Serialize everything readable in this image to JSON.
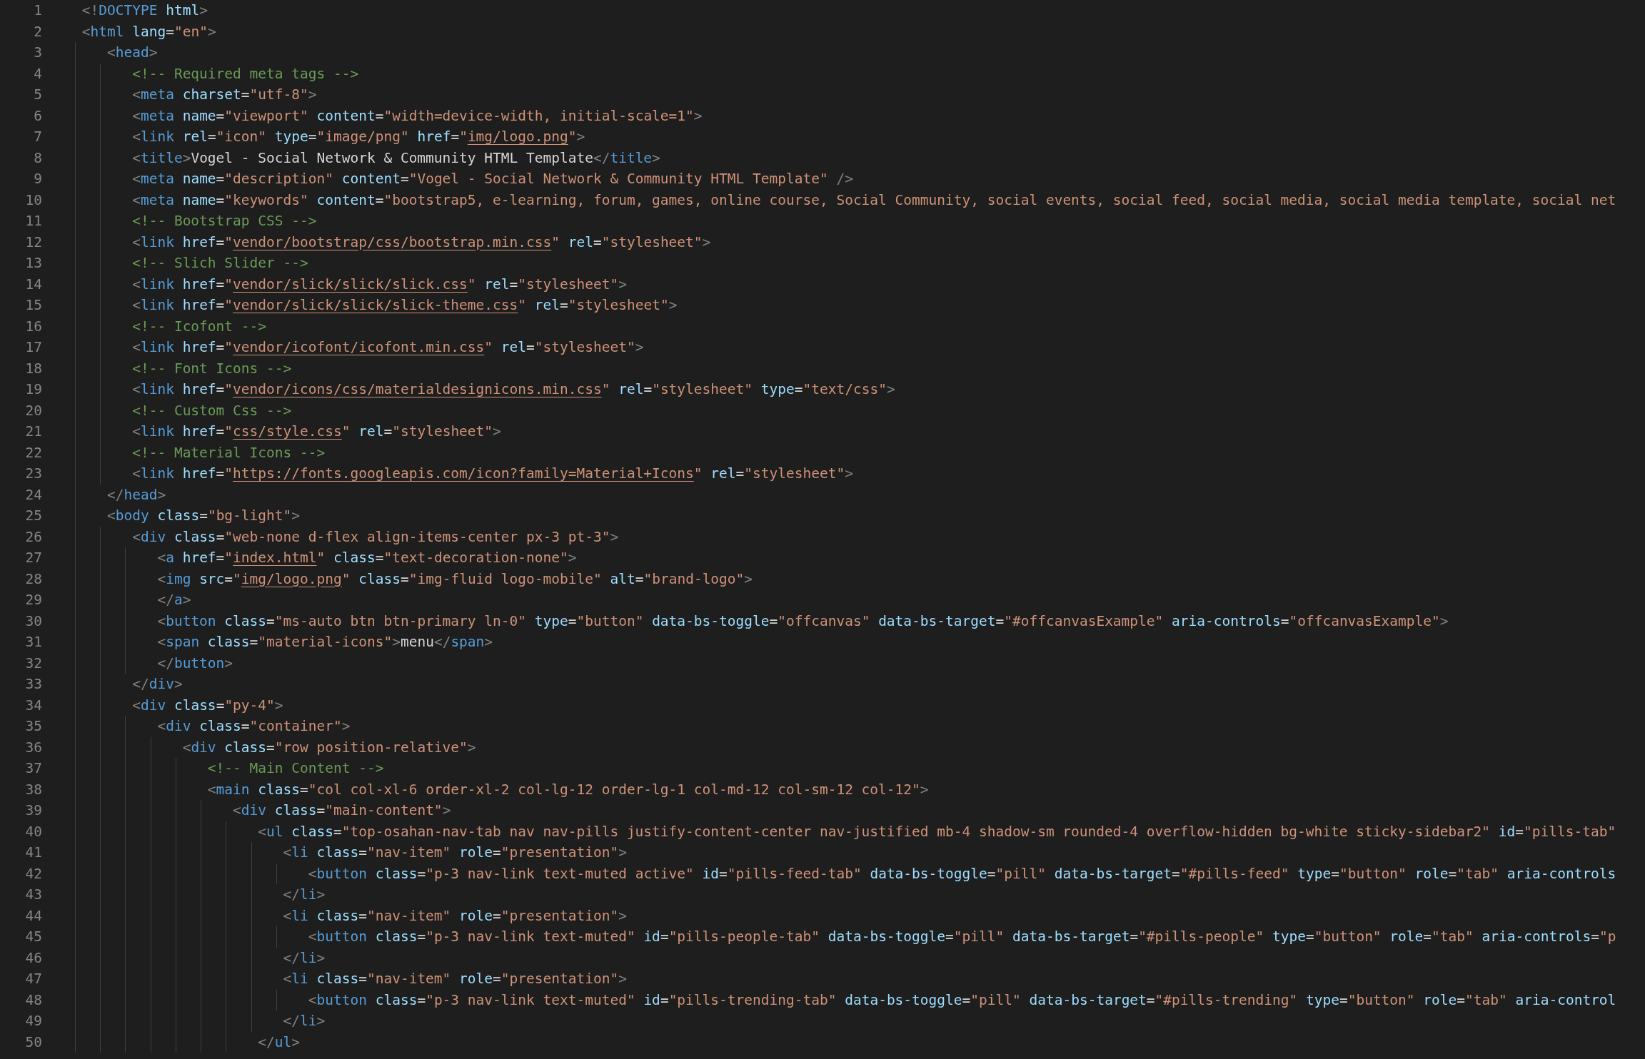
{
  "lines": [
    {
      "number": "1",
      "code": [
        {
          "kind": "p",
          "text": "<!"
        },
        {
          "kind": "g",
          "text": "DOCTYPE"
        },
        {
          "kind": "a",
          "text": " html"
        },
        {
          "kind": "p",
          "text": ">"
        }
      ]
    },
    {
      "number": "2",
      "code": [
        {
          "kind": "p",
          "text": "<"
        },
        {
          "kind": "g",
          "text": "html"
        },
        {
          "kind": "a",
          "text": " lang"
        },
        {
          "kind": "x",
          "text": "="
        },
        {
          "kind": "s",
          "text": "\"en\""
        },
        {
          "kind": "p",
          "text": ">"
        }
      ]
    },
    {
      "number": "3",
      "code": [
        {
          "kind": "p",
          "text": "   <"
        },
        {
          "kind": "g",
          "text": "head"
        },
        {
          "kind": "p",
          "text": ">"
        }
      ]
    },
    {
      "number": "4",
      "code": [
        {
          "kind": "c",
          "text": "      <!-- Required meta tags -->"
        }
      ]
    },
    {
      "number": "5",
      "code": [
        {
          "kind": "p",
          "text": "      <"
        },
        {
          "kind": "g",
          "text": "meta"
        },
        {
          "kind": "a",
          "text": " charset"
        },
        {
          "kind": "x",
          "text": "="
        },
        {
          "kind": "s",
          "text": "\"utf-8\""
        },
        {
          "kind": "p",
          "text": ">"
        }
      ]
    },
    {
      "number": "6",
      "code": [
        {
          "kind": "p",
          "text": "      <"
        },
        {
          "kind": "g",
          "text": "meta"
        },
        {
          "kind": "a",
          "text": " name"
        },
        {
          "kind": "x",
          "text": "="
        },
        {
          "kind": "s",
          "text": "\"viewport\""
        },
        {
          "kind": "a",
          "text": " content"
        },
        {
          "kind": "x",
          "text": "="
        },
        {
          "kind": "s",
          "text": "\"width=device-width, initial-scale=1\""
        },
        {
          "kind": "p",
          "text": ">"
        }
      ]
    },
    {
      "number": "7",
      "code": [
        {
          "kind": "p",
          "text": "      <"
        },
        {
          "kind": "g",
          "text": "link"
        },
        {
          "kind": "a",
          "text": " rel"
        },
        {
          "kind": "x",
          "text": "="
        },
        {
          "kind": "s",
          "text": "\"icon\""
        },
        {
          "kind": "a",
          "text": " type"
        },
        {
          "kind": "x",
          "text": "="
        },
        {
          "kind": "s",
          "text": "\"image/png\""
        },
        {
          "kind": "a",
          "text": " href"
        },
        {
          "kind": "x",
          "text": "="
        },
        {
          "kind": "s",
          "text": "\""
        },
        {
          "kind": "u",
          "text": "img/logo.png"
        },
        {
          "kind": "s",
          "text": "\""
        },
        {
          "kind": "p",
          "text": ">"
        }
      ]
    },
    {
      "number": "8",
      "code": [
        {
          "kind": "p",
          "text": "      <"
        },
        {
          "kind": "g",
          "text": "title"
        },
        {
          "kind": "p",
          "text": ">"
        },
        {
          "kind": "x",
          "text": "Vogel - Social Network & Community HTML Template"
        },
        {
          "kind": "p",
          "text": "</"
        },
        {
          "kind": "g",
          "text": "title"
        },
        {
          "kind": "p",
          "text": ">"
        }
      ]
    },
    {
      "number": "9",
      "code": [
        {
          "kind": "p",
          "text": "      <"
        },
        {
          "kind": "g",
          "text": "meta"
        },
        {
          "kind": "a",
          "text": " name"
        },
        {
          "kind": "x",
          "text": "="
        },
        {
          "kind": "s",
          "text": "\"description\""
        },
        {
          "kind": "a",
          "text": " content"
        },
        {
          "kind": "x",
          "text": "="
        },
        {
          "kind": "s",
          "text": "\"Vogel - Social Network & Community HTML Template\""
        },
        {
          "kind": "p",
          "text": " />"
        }
      ]
    },
    {
      "number": "10",
      "code": [
        {
          "kind": "p",
          "text": "      <"
        },
        {
          "kind": "g",
          "text": "meta"
        },
        {
          "kind": "a",
          "text": " name"
        },
        {
          "kind": "x",
          "text": "="
        },
        {
          "kind": "s",
          "text": "\"keywords\""
        },
        {
          "kind": "a",
          "text": " content"
        },
        {
          "kind": "x",
          "text": "="
        },
        {
          "kind": "s",
          "text": "\"bootstrap5, e-learning, forum, games, online course, Social Community, social events, social feed, social media, social media template, social net"
        }
      ]
    },
    {
      "number": "11",
      "code": [
        {
          "kind": "c",
          "text": "      <!-- Bootstrap CSS -->"
        }
      ]
    },
    {
      "number": "12",
      "code": [
        {
          "kind": "p",
          "text": "      <"
        },
        {
          "kind": "g",
          "text": "link"
        },
        {
          "kind": "a",
          "text": " href"
        },
        {
          "kind": "x",
          "text": "="
        },
        {
          "kind": "s",
          "text": "\""
        },
        {
          "kind": "u",
          "text": "vendor/bootstrap/css/bootstrap.min.css"
        },
        {
          "kind": "s",
          "text": "\""
        },
        {
          "kind": "a",
          "text": " rel"
        },
        {
          "kind": "x",
          "text": "="
        },
        {
          "kind": "s",
          "text": "\"stylesheet\""
        },
        {
          "kind": "p",
          "text": ">"
        }
      ]
    },
    {
      "number": "13",
      "code": [
        {
          "kind": "c",
          "text": "      <!-- Slich Slider -->"
        }
      ]
    },
    {
      "number": "14",
      "code": [
        {
          "kind": "p",
          "text": "      <"
        },
        {
          "kind": "g",
          "text": "link"
        },
        {
          "kind": "a",
          "text": " href"
        },
        {
          "kind": "x",
          "text": "="
        },
        {
          "kind": "s",
          "text": "\""
        },
        {
          "kind": "u",
          "text": "vendor/slick/slick/slick.css"
        },
        {
          "kind": "s",
          "text": "\""
        },
        {
          "kind": "a",
          "text": " rel"
        },
        {
          "kind": "x",
          "text": "="
        },
        {
          "kind": "s",
          "text": "\"stylesheet\""
        },
        {
          "kind": "p",
          "text": ">"
        }
      ]
    },
    {
      "number": "15",
      "code": [
        {
          "kind": "p",
          "text": "      <"
        },
        {
          "kind": "g",
          "text": "link"
        },
        {
          "kind": "a",
          "text": " href"
        },
        {
          "kind": "x",
          "text": "="
        },
        {
          "kind": "s",
          "text": "\""
        },
        {
          "kind": "u",
          "text": "vendor/slick/slick/slick-theme.css"
        },
        {
          "kind": "s",
          "text": "\""
        },
        {
          "kind": "a",
          "text": " rel"
        },
        {
          "kind": "x",
          "text": "="
        },
        {
          "kind": "s",
          "text": "\"stylesheet\""
        },
        {
          "kind": "p",
          "text": ">"
        }
      ]
    },
    {
      "number": "16",
      "code": [
        {
          "kind": "c",
          "text": "      <!-- Icofont -->"
        }
      ]
    },
    {
      "number": "17",
      "code": [
        {
          "kind": "p",
          "text": "      <"
        },
        {
          "kind": "g",
          "text": "link"
        },
        {
          "kind": "a",
          "text": " href"
        },
        {
          "kind": "x",
          "text": "="
        },
        {
          "kind": "s",
          "text": "\""
        },
        {
          "kind": "u",
          "text": "vendor/icofont/icofont.min.css"
        },
        {
          "kind": "s",
          "text": "\""
        },
        {
          "kind": "a",
          "text": " rel"
        },
        {
          "kind": "x",
          "text": "="
        },
        {
          "kind": "s",
          "text": "\"stylesheet\""
        },
        {
          "kind": "p",
          "text": ">"
        }
      ]
    },
    {
      "number": "18",
      "code": [
        {
          "kind": "c",
          "text": "      <!-- Font Icons -->"
        }
      ]
    },
    {
      "number": "19",
      "code": [
        {
          "kind": "p",
          "text": "      <"
        },
        {
          "kind": "g",
          "text": "link"
        },
        {
          "kind": "a",
          "text": " href"
        },
        {
          "kind": "x",
          "text": "="
        },
        {
          "kind": "s",
          "text": "\""
        },
        {
          "kind": "u",
          "text": "vendor/icons/css/materialdesignicons.min.css"
        },
        {
          "kind": "s",
          "text": "\""
        },
        {
          "kind": "a",
          "text": " rel"
        },
        {
          "kind": "x",
          "text": "="
        },
        {
          "kind": "s",
          "text": "\"stylesheet\""
        },
        {
          "kind": "a",
          "text": " type"
        },
        {
          "kind": "x",
          "text": "="
        },
        {
          "kind": "s",
          "text": "\"text/css\""
        },
        {
          "kind": "p",
          "text": ">"
        }
      ]
    },
    {
      "number": "20",
      "code": [
        {
          "kind": "c",
          "text": "      <!-- Custom Css -->"
        }
      ]
    },
    {
      "number": "21",
      "code": [
        {
          "kind": "p",
          "text": "      <"
        },
        {
          "kind": "g",
          "text": "link"
        },
        {
          "kind": "a",
          "text": " href"
        },
        {
          "kind": "x",
          "text": "="
        },
        {
          "kind": "s",
          "text": "\""
        },
        {
          "kind": "u",
          "text": "css/style.css"
        },
        {
          "kind": "s",
          "text": "\""
        },
        {
          "kind": "a",
          "text": " rel"
        },
        {
          "kind": "x",
          "text": "="
        },
        {
          "kind": "s",
          "text": "\"stylesheet\""
        },
        {
          "kind": "p",
          "text": ">"
        }
      ]
    },
    {
      "number": "22",
      "code": [
        {
          "kind": "c",
          "text": "      <!-- Material Icons -->"
        }
      ]
    },
    {
      "number": "23",
      "code": [
        {
          "kind": "p",
          "text": "      <"
        },
        {
          "kind": "g",
          "text": "link"
        },
        {
          "kind": "a",
          "text": " href"
        },
        {
          "kind": "x",
          "text": "="
        },
        {
          "kind": "s",
          "text": "\""
        },
        {
          "kind": "u",
          "text": "https://fonts.googleapis.com/icon?family=Material+Icons"
        },
        {
          "kind": "s",
          "text": "\""
        },
        {
          "kind": "a",
          "text": " rel"
        },
        {
          "kind": "x",
          "text": "="
        },
        {
          "kind": "s",
          "text": "\"stylesheet\""
        },
        {
          "kind": "p",
          "text": ">"
        }
      ]
    },
    {
      "number": "24",
      "code": [
        {
          "kind": "p",
          "text": "   </"
        },
        {
          "kind": "g",
          "text": "head"
        },
        {
          "kind": "p",
          "text": ">"
        }
      ]
    },
    {
      "number": "25",
      "code": [
        {
          "kind": "p",
          "text": "   <"
        },
        {
          "kind": "g",
          "text": "body"
        },
        {
          "kind": "a",
          "text": " class"
        },
        {
          "kind": "x",
          "text": "="
        },
        {
          "kind": "s",
          "text": "\"bg-light\""
        },
        {
          "kind": "p",
          "text": ">"
        }
      ]
    },
    {
      "number": "26",
      "code": [
        {
          "kind": "p",
          "text": "      <"
        },
        {
          "kind": "g",
          "text": "div"
        },
        {
          "kind": "a",
          "text": " class"
        },
        {
          "kind": "x",
          "text": "="
        },
        {
          "kind": "s",
          "text": "\"web-none d-flex align-items-center px-3 pt-3\""
        },
        {
          "kind": "p",
          "text": ">"
        }
      ]
    },
    {
      "number": "27",
      "code": [
        {
          "kind": "p",
          "text": "         <"
        },
        {
          "kind": "g",
          "text": "a"
        },
        {
          "kind": "a",
          "text": " href"
        },
        {
          "kind": "x",
          "text": "="
        },
        {
          "kind": "s",
          "text": "\""
        },
        {
          "kind": "u",
          "text": "index.html"
        },
        {
          "kind": "s",
          "text": "\""
        },
        {
          "kind": "a",
          "text": " class"
        },
        {
          "kind": "x",
          "text": "="
        },
        {
          "kind": "s",
          "text": "\"text-decoration-none\""
        },
        {
          "kind": "p",
          "text": ">"
        }
      ]
    },
    {
      "number": "28",
      "code": [
        {
          "kind": "p",
          "text": "         <"
        },
        {
          "kind": "g",
          "text": "img"
        },
        {
          "kind": "a",
          "text": " src"
        },
        {
          "kind": "x",
          "text": "="
        },
        {
          "kind": "s",
          "text": "\""
        },
        {
          "kind": "u",
          "text": "img/logo.png"
        },
        {
          "kind": "s",
          "text": "\""
        },
        {
          "kind": "a",
          "text": " class"
        },
        {
          "kind": "x",
          "text": "="
        },
        {
          "kind": "s",
          "text": "\"img-fluid logo-mobile\""
        },
        {
          "kind": "a",
          "text": " alt"
        },
        {
          "kind": "x",
          "text": "="
        },
        {
          "kind": "s",
          "text": "\"brand-logo\""
        },
        {
          "kind": "p",
          "text": ">"
        }
      ]
    },
    {
      "number": "29",
      "code": [
        {
          "kind": "p",
          "text": "         </"
        },
        {
          "kind": "g",
          "text": "a"
        },
        {
          "kind": "p",
          "text": ">"
        }
      ]
    },
    {
      "number": "30",
      "code": [
        {
          "kind": "p",
          "text": "         <"
        },
        {
          "kind": "g",
          "text": "button"
        },
        {
          "kind": "a",
          "text": " class"
        },
        {
          "kind": "x",
          "text": "="
        },
        {
          "kind": "s",
          "text": "\"ms-auto btn btn-primary ln-0\""
        },
        {
          "kind": "a",
          "text": " type"
        },
        {
          "kind": "x",
          "text": "="
        },
        {
          "kind": "s",
          "text": "\"button\""
        },
        {
          "kind": "a",
          "text": " data-bs-toggle"
        },
        {
          "kind": "x",
          "text": "="
        },
        {
          "kind": "s",
          "text": "\"offcanvas\""
        },
        {
          "kind": "a",
          "text": " data-bs-target"
        },
        {
          "kind": "x",
          "text": "="
        },
        {
          "kind": "s",
          "text": "\"#offcanvasExample\""
        },
        {
          "kind": "a",
          "text": " aria-controls"
        },
        {
          "kind": "x",
          "text": "="
        },
        {
          "kind": "s",
          "text": "\"offcanvasExample\""
        },
        {
          "kind": "p",
          "text": ">"
        }
      ]
    },
    {
      "number": "31",
      "code": [
        {
          "kind": "p",
          "text": "         <"
        },
        {
          "kind": "g",
          "text": "span"
        },
        {
          "kind": "a",
          "text": " class"
        },
        {
          "kind": "x",
          "text": "="
        },
        {
          "kind": "s",
          "text": "\"material-icons\""
        },
        {
          "kind": "p",
          "text": ">"
        },
        {
          "kind": "x",
          "text": "menu"
        },
        {
          "kind": "p",
          "text": "</"
        },
        {
          "kind": "g",
          "text": "span"
        },
        {
          "kind": "p",
          "text": ">"
        }
      ]
    },
    {
      "number": "32",
      "code": [
        {
          "kind": "p",
          "text": "         </"
        },
        {
          "kind": "g",
          "text": "button"
        },
        {
          "kind": "p",
          "text": ">"
        }
      ]
    },
    {
      "number": "33",
      "code": [
        {
          "kind": "p",
          "text": "      </"
        },
        {
          "kind": "g",
          "text": "div"
        },
        {
          "kind": "p",
          "text": ">"
        }
      ]
    },
    {
      "number": "34",
      "code": [
        {
          "kind": "p",
          "text": "      <"
        },
        {
          "kind": "g",
          "text": "div"
        },
        {
          "kind": "a",
          "text": " class"
        },
        {
          "kind": "x",
          "text": "="
        },
        {
          "kind": "s",
          "text": "\"py-4\""
        },
        {
          "kind": "p",
          "text": ">"
        }
      ]
    },
    {
      "number": "35",
      "code": [
        {
          "kind": "p",
          "text": "         <"
        },
        {
          "kind": "g",
          "text": "div"
        },
        {
          "kind": "a",
          "text": " class"
        },
        {
          "kind": "x",
          "text": "="
        },
        {
          "kind": "s",
          "text": "\"container\""
        },
        {
          "kind": "p",
          "text": ">"
        }
      ]
    },
    {
      "number": "36",
      "code": [
        {
          "kind": "p",
          "text": "            <"
        },
        {
          "kind": "g",
          "text": "div"
        },
        {
          "kind": "a",
          "text": " class"
        },
        {
          "kind": "x",
          "text": "="
        },
        {
          "kind": "s",
          "text": "\"row position-relative\""
        },
        {
          "kind": "p",
          "text": ">"
        }
      ]
    },
    {
      "number": "37",
      "code": [
        {
          "kind": "c",
          "text": "               <!-- Main Content -->"
        }
      ]
    },
    {
      "number": "38",
      "code": [
        {
          "kind": "p",
          "text": "               <"
        },
        {
          "kind": "g",
          "text": "main"
        },
        {
          "kind": "a",
          "text": " class"
        },
        {
          "kind": "x",
          "text": "="
        },
        {
          "kind": "s",
          "text": "\"col col-xl-6 order-xl-2 col-lg-12 order-lg-1 col-md-12 col-sm-12 col-12\""
        },
        {
          "kind": "p",
          "text": ">"
        }
      ]
    },
    {
      "number": "39",
      "code": [
        {
          "kind": "p",
          "text": "                  <"
        },
        {
          "kind": "g",
          "text": "div"
        },
        {
          "kind": "a",
          "text": " class"
        },
        {
          "kind": "x",
          "text": "="
        },
        {
          "kind": "s",
          "text": "\"main-content\""
        },
        {
          "kind": "p",
          "text": ">"
        }
      ]
    },
    {
      "number": "40",
      "code": [
        {
          "kind": "p",
          "text": "                     <"
        },
        {
          "kind": "g",
          "text": "ul"
        },
        {
          "kind": "a",
          "text": " class"
        },
        {
          "kind": "x",
          "text": "="
        },
        {
          "kind": "s",
          "text": "\"top-osahan-nav-tab nav nav-pills justify-content-center nav-justified mb-4 shadow-sm rounded-4 overflow-hidden bg-white sticky-sidebar2\""
        },
        {
          "kind": "a",
          "text": " id"
        },
        {
          "kind": "x",
          "text": "="
        },
        {
          "kind": "s",
          "text": "\"pills-tab\""
        }
      ]
    },
    {
      "number": "41",
      "code": [
        {
          "kind": "p",
          "text": "                        <"
        },
        {
          "kind": "g",
          "text": "li"
        },
        {
          "kind": "a",
          "text": " class"
        },
        {
          "kind": "x",
          "text": "="
        },
        {
          "kind": "s",
          "text": "\"nav-item\""
        },
        {
          "kind": "a",
          "text": " role"
        },
        {
          "kind": "x",
          "text": "="
        },
        {
          "kind": "s",
          "text": "\"presentation\""
        },
        {
          "kind": "p",
          "text": ">"
        }
      ]
    },
    {
      "number": "42",
      "code": [
        {
          "kind": "p",
          "text": "                           <"
        },
        {
          "kind": "g",
          "text": "button"
        },
        {
          "kind": "a",
          "text": " class"
        },
        {
          "kind": "x",
          "text": "="
        },
        {
          "kind": "s",
          "text": "\"p-3 nav-link text-muted active\""
        },
        {
          "kind": "a",
          "text": " id"
        },
        {
          "kind": "x",
          "text": "="
        },
        {
          "kind": "s",
          "text": "\"pills-feed-tab\""
        },
        {
          "kind": "a",
          "text": " data-bs-toggle"
        },
        {
          "kind": "x",
          "text": "="
        },
        {
          "kind": "s",
          "text": "\"pill\""
        },
        {
          "kind": "a",
          "text": " data-bs-target"
        },
        {
          "kind": "x",
          "text": "="
        },
        {
          "kind": "s",
          "text": "\"#pills-feed\""
        },
        {
          "kind": "a",
          "text": " type"
        },
        {
          "kind": "x",
          "text": "="
        },
        {
          "kind": "s",
          "text": "\"button\""
        },
        {
          "kind": "a",
          "text": " role"
        },
        {
          "kind": "x",
          "text": "="
        },
        {
          "kind": "s",
          "text": "\"tab\""
        },
        {
          "kind": "a",
          "text": " aria-controls"
        }
      ]
    },
    {
      "number": "43",
      "code": [
        {
          "kind": "p",
          "text": "                        </"
        },
        {
          "kind": "g",
          "text": "li"
        },
        {
          "kind": "p",
          "text": ">"
        }
      ]
    },
    {
      "number": "44",
      "code": [
        {
          "kind": "p",
          "text": "                        <"
        },
        {
          "kind": "g",
          "text": "li"
        },
        {
          "kind": "a",
          "text": " class"
        },
        {
          "kind": "x",
          "text": "="
        },
        {
          "kind": "s",
          "text": "\"nav-item\""
        },
        {
          "kind": "a",
          "text": " role"
        },
        {
          "kind": "x",
          "text": "="
        },
        {
          "kind": "s",
          "text": "\"presentation\""
        },
        {
          "kind": "p",
          "text": ">"
        }
      ]
    },
    {
      "number": "45",
      "code": [
        {
          "kind": "p",
          "text": "                           <"
        },
        {
          "kind": "g",
          "text": "button"
        },
        {
          "kind": "a",
          "text": " class"
        },
        {
          "kind": "x",
          "text": "="
        },
        {
          "kind": "s",
          "text": "\"p-3 nav-link text-muted\""
        },
        {
          "kind": "a",
          "text": " id"
        },
        {
          "kind": "x",
          "text": "="
        },
        {
          "kind": "s",
          "text": "\"pills-people-tab\""
        },
        {
          "kind": "a",
          "text": " data-bs-toggle"
        },
        {
          "kind": "x",
          "text": "="
        },
        {
          "kind": "s",
          "text": "\"pill\""
        },
        {
          "kind": "a",
          "text": " data-bs-target"
        },
        {
          "kind": "x",
          "text": "="
        },
        {
          "kind": "s",
          "text": "\"#pills-people\""
        },
        {
          "kind": "a",
          "text": " type"
        },
        {
          "kind": "x",
          "text": "="
        },
        {
          "kind": "s",
          "text": "\"button\""
        },
        {
          "kind": "a",
          "text": " role"
        },
        {
          "kind": "x",
          "text": "="
        },
        {
          "kind": "s",
          "text": "\"tab\""
        },
        {
          "kind": "a",
          "text": " aria-controls"
        },
        {
          "kind": "x",
          "text": "="
        },
        {
          "kind": "s",
          "text": "\"p"
        }
      ]
    },
    {
      "number": "46",
      "code": [
        {
          "kind": "p",
          "text": "                        </"
        },
        {
          "kind": "g",
          "text": "li"
        },
        {
          "kind": "p",
          "text": ">"
        }
      ]
    },
    {
      "number": "47",
      "code": [
        {
          "kind": "p",
          "text": "                        <"
        },
        {
          "kind": "g",
          "text": "li"
        },
        {
          "kind": "a",
          "text": " class"
        },
        {
          "kind": "x",
          "text": "="
        },
        {
          "kind": "s",
          "text": "\"nav-item\""
        },
        {
          "kind": "a",
          "text": " role"
        },
        {
          "kind": "x",
          "text": "="
        },
        {
          "kind": "s",
          "text": "\"presentation\""
        },
        {
          "kind": "p",
          "text": ">"
        }
      ]
    },
    {
      "number": "48",
      "code": [
        {
          "kind": "p",
          "text": "                           <"
        },
        {
          "kind": "g",
          "text": "button"
        },
        {
          "kind": "a",
          "text": " class"
        },
        {
          "kind": "x",
          "text": "="
        },
        {
          "kind": "s",
          "text": "\"p-3 nav-link text-muted\""
        },
        {
          "kind": "a",
          "text": " id"
        },
        {
          "kind": "x",
          "text": "="
        },
        {
          "kind": "s",
          "text": "\"pills-trending-tab\""
        },
        {
          "kind": "a",
          "text": " data-bs-toggle"
        },
        {
          "kind": "x",
          "text": "="
        },
        {
          "kind": "s",
          "text": "\"pill\""
        },
        {
          "kind": "a",
          "text": " data-bs-target"
        },
        {
          "kind": "x",
          "text": "="
        },
        {
          "kind": "s",
          "text": "\"#pills-trending\""
        },
        {
          "kind": "a",
          "text": " type"
        },
        {
          "kind": "x",
          "text": "="
        },
        {
          "kind": "s",
          "text": "\"button\""
        },
        {
          "kind": "a",
          "text": " role"
        },
        {
          "kind": "x",
          "text": "="
        },
        {
          "kind": "s",
          "text": "\"tab\""
        },
        {
          "kind": "a",
          "text": " aria-control"
        }
      ]
    },
    {
      "number": "49",
      "code": [
        {
          "kind": "p",
          "text": "                        </"
        },
        {
          "kind": "g",
          "text": "li"
        },
        {
          "kind": "p",
          "text": ">"
        }
      ]
    },
    {
      "number": "50",
      "code": [
        {
          "kind": "p",
          "text": "                     </"
        },
        {
          "kind": "g",
          "text": "ul"
        },
        {
          "kind": "p",
          "text": ">"
        }
      ]
    }
  ]
}
